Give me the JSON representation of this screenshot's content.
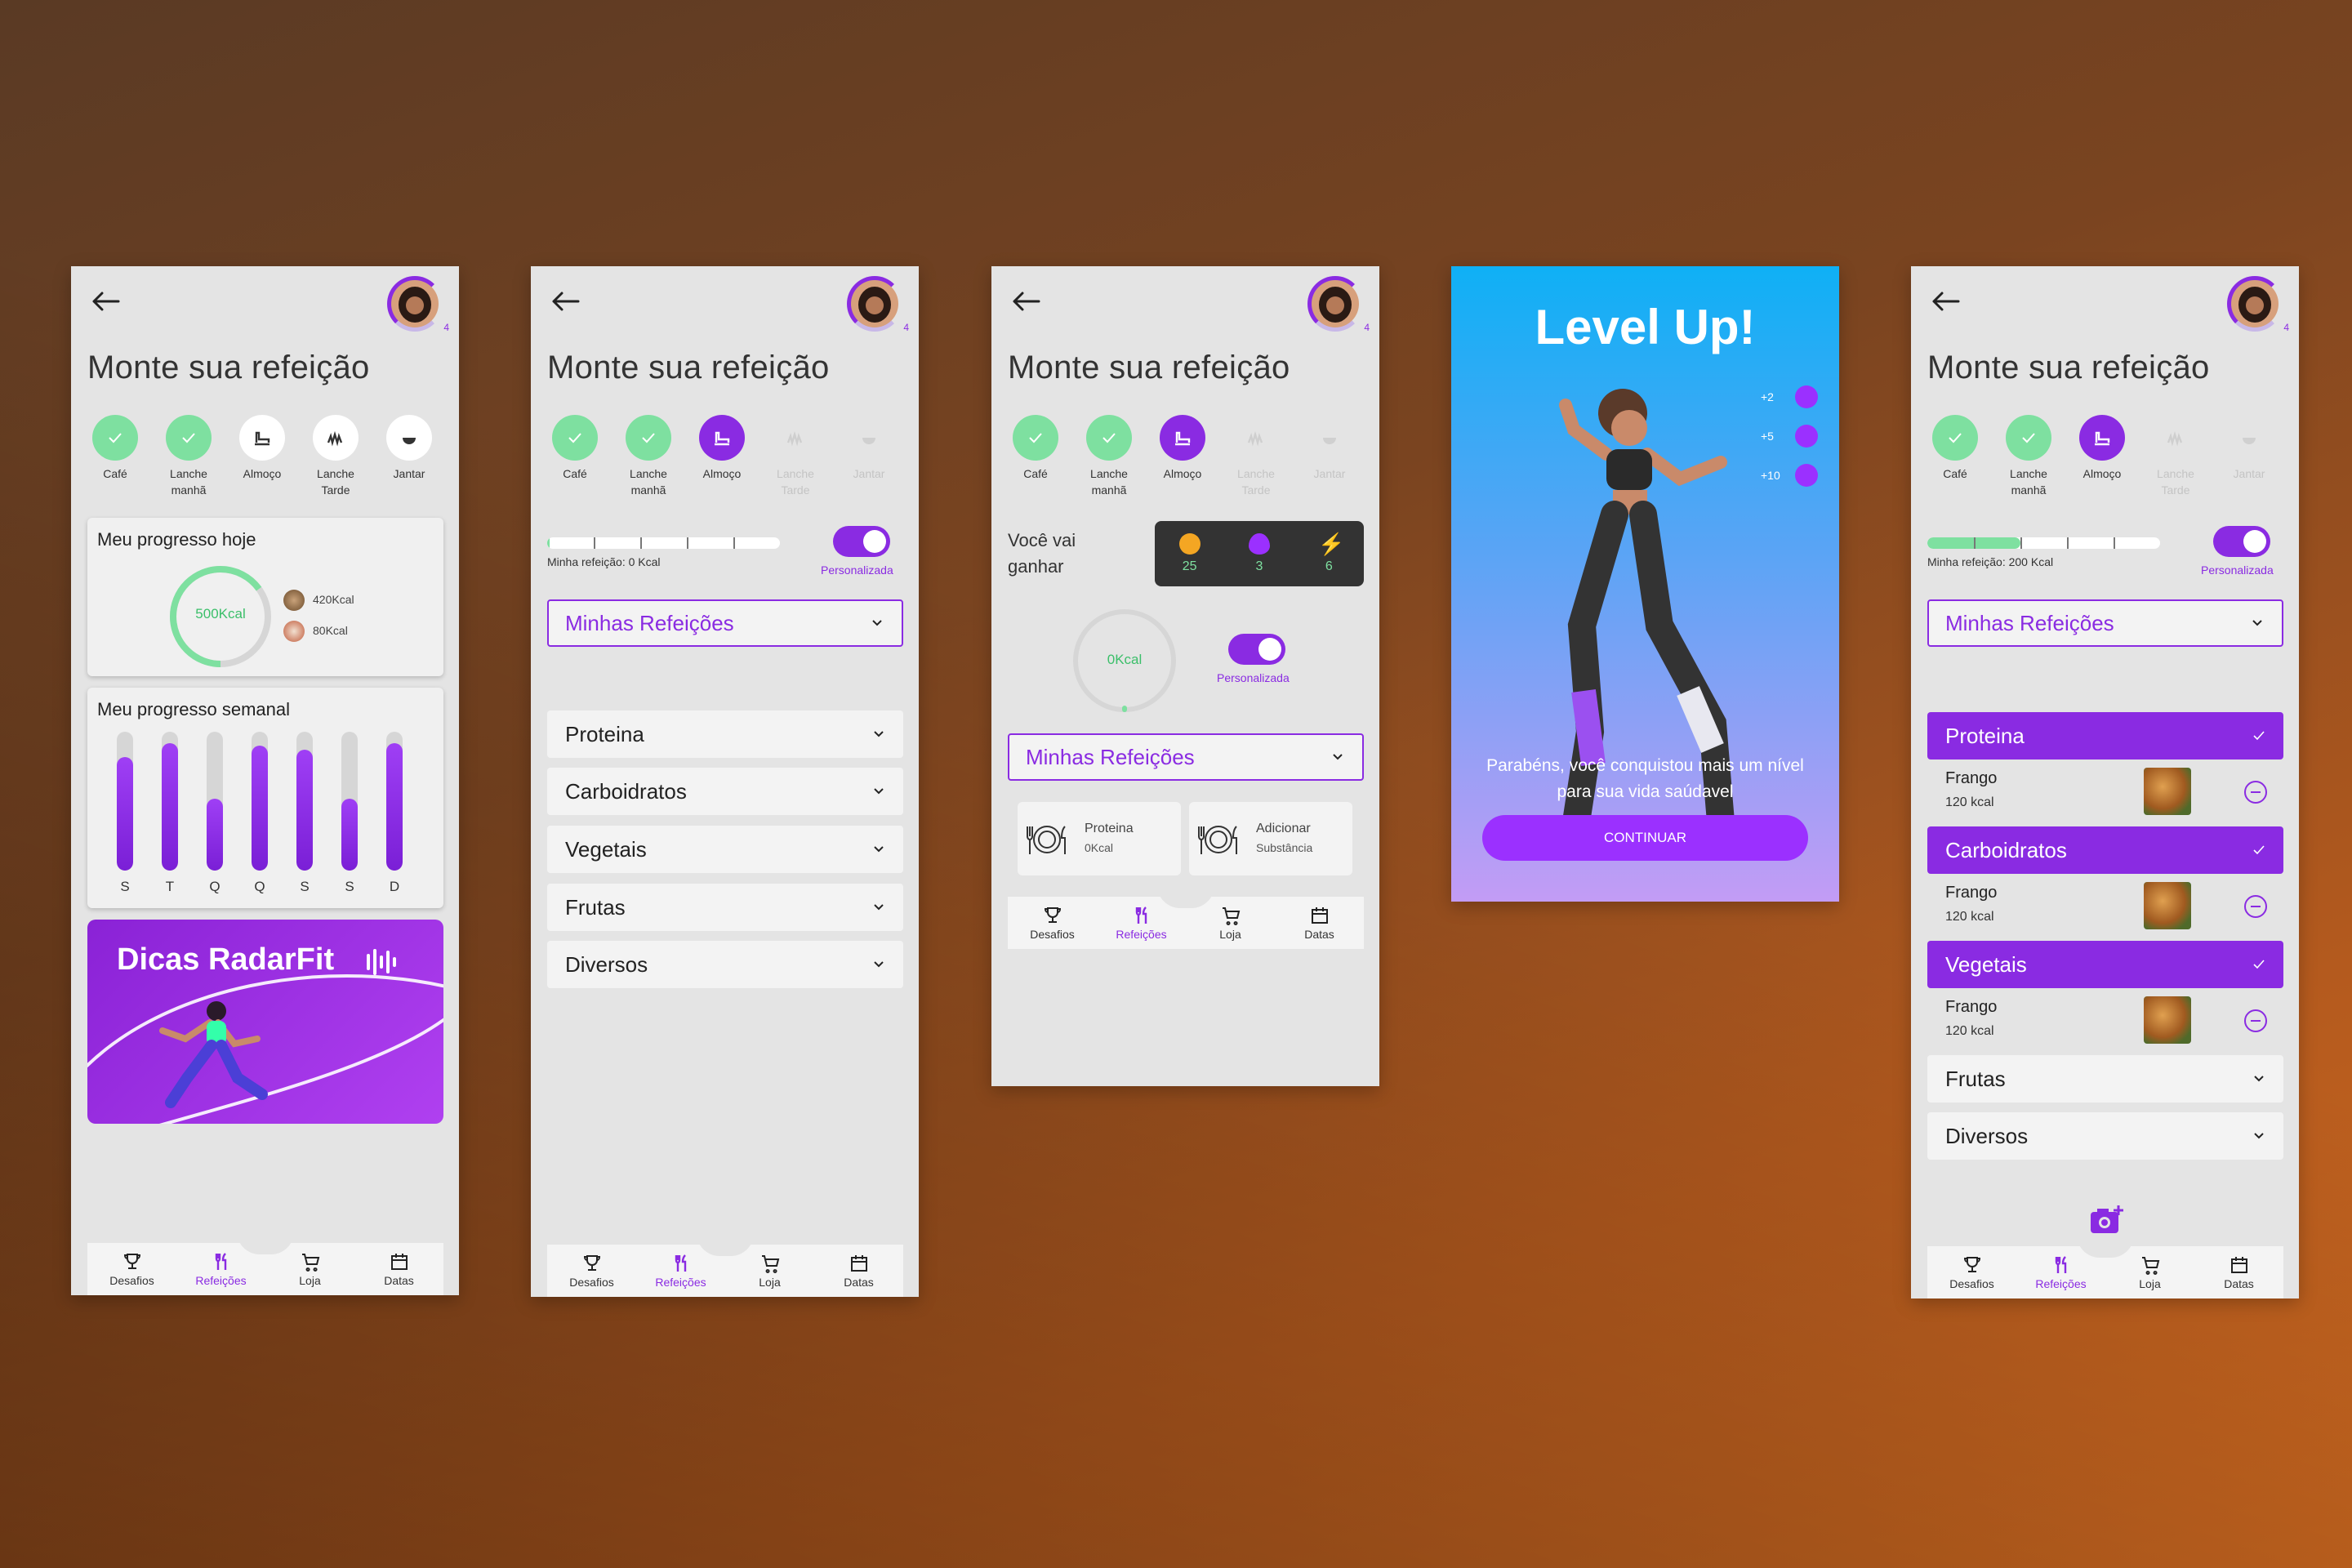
{
  "common": {
    "title": "Monte sua refeição",
    "level": "4",
    "meals": [
      "Café",
      "Lanche manhã",
      "Almoço",
      "Lanche Tarde",
      "Jantar"
    ],
    "nav": [
      "Desafios",
      "Refeições",
      "Loja",
      "Datas"
    ],
    "minhas_refeicoes": "Minhas Refeições",
    "personalizada": "Personalizada"
  },
  "screen1": {
    "progress_today": {
      "title": "Meu progresso hoje",
      "center": "500Kcal",
      "fraction": 0.65,
      "items": [
        "420Kcal",
        "80Kcal"
      ]
    },
    "weekly": {
      "title": "Meu progresso semanal",
      "days": [
        "S",
        "T",
        "Q",
        "Q",
        "S",
        "S",
        "D"
      ],
      "values": [
        0.82,
        0.92,
        0.52,
        0.9,
        0.87,
        0.52,
        0.92
      ]
    },
    "dicas": "Dicas RadarFit"
  },
  "screen2": {
    "progress_label": "Minha refeição: 0 Kcal",
    "progress": 0.0,
    "categories": [
      "Proteina",
      "Carboidratos",
      "Vegetais",
      "Frutas",
      "Diversos"
    ]
  },
  "screen3": {
    "gain_label": "Você vai ganhar",
    "gains": [
      "25",
      "3",
      "6"
    ],
    "center": "0Kcal",
    "cards": [
      {
        "l1": "Proteina",
        "l2": "0Kcal"
      },
      {
        "l1": "Adicionar",
        "l2": "Substância"
      }
    ]
  },
  "screen4": {
    "title": "Level Up!",
    "rewards": [
      "+2",
      "+5",
      "+10"
    ],
    "message": "Parabéns, você conquistou mais um nível para sua vida saúdavel",
    "button": "CONTINUAR"
  },
  "screen5": {
    "progress_label": "Minha refeição: 200 Kcal",
    "progress": 0.4,
    "categories_on": [
      "Proteina",
      "Carboidratos",
      "Vegetais"
    ],
    "item": {
      "name": "Frango",
      "kcal": "120 kcal"
    },
    "categories_off": [
      "Frutas",
      "Diversos"
    ]
  },
  "colors": {
    "accent": "#8a2be2",
    "success": "#7ee0a0",
    "background": "#e4e4e4"
  }
}
